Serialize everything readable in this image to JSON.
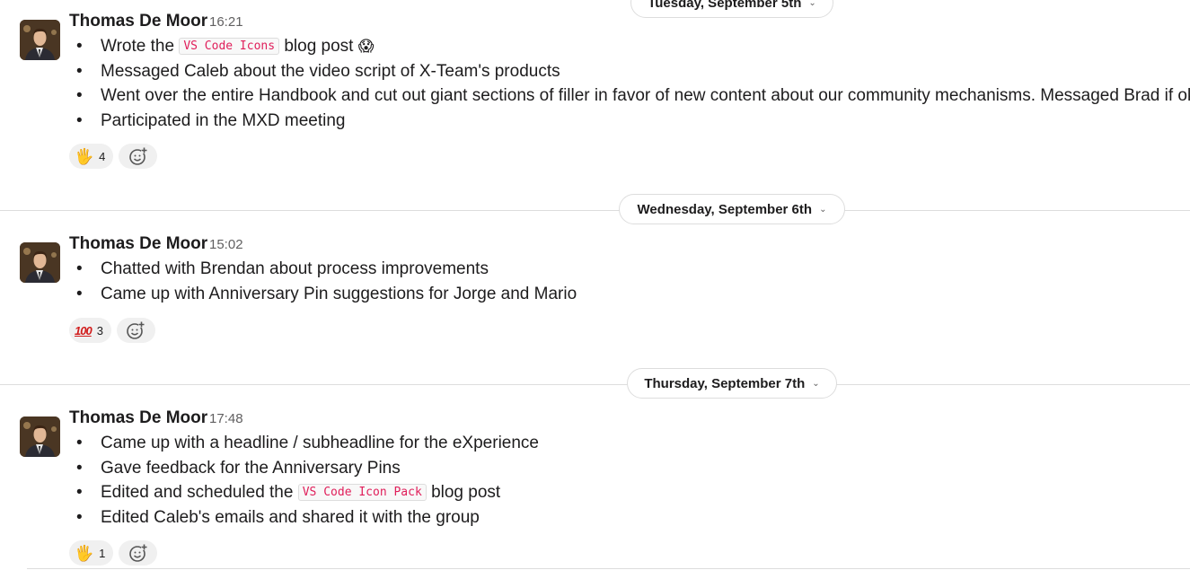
{
  "messages": [
    {
      "author": "Thomas De Moor",
      "time": "16:21",
      "items": [
        {
          "before": "Wrote the ",
          "code": "VS Code Icons",
          "after": " blog post",
          "emoji": "😱"
        },
        {
          "text": "Messaged Caleb about the video script of X-Team's products"
        },
        {
          "text": "Went over the entire Handbook and cut out giant sections of filler in favor of new content about our community mechanisms. Messaged Brad if ok"
        },
        {
          "text": "Participated in the MXD meeting"
        }
      ],
      "reaction": {
        "icon": "raised-hand-icon",
        "glyph": "🖐",
        "count": "4"
      }
    },
    {
      "author": "Thomas De Moor",
      "time": "15:02",
      "items": [
        {
          "text": "Chatted with Brendan about process improvements"
        },
        {
          "text": "Came up with Anniversary Pin suggestions for Jorge and Mario"
        }
      ],
      "reaction": {
        "icon": "hundred-points-icon",
        "glyph": "100",
        "count": "3"
      }
    },
    {
      "author": "Thomas De Moor",
      "time": "17:48",
      "items": [
        {
          "text": "Came up with a headline / subheadline for the eXperience"
        },
        {
          "text": "Gave feedback for the Anniversary Pins"
        },
        {
          "before": "Edited and scheduled the ",
          "code": "VS Code Icon Pack",
          "after": " blog post"
        },
        {
          "text": "Edited Caleb's emails and shared it with the group"
        }
      ],
      "reaction": {
        "icon": "raised-hand-icon",
        "glyph": "🖐",
        "count": "1"
      }
    }
  ],
  "dates": [
    "Tuesday, September 5th",
    "Wednesday, September 6th",
    "Thursday, September 7th"
  ],
  "bullet": "•",
  "chevron": "⌄",
  "colors": {
    "code": "#e01e5a",
    "divider": "#dddddd",
    "reaction_bg": "#f0f0f0",
    "time": "#616061"
  }
}
